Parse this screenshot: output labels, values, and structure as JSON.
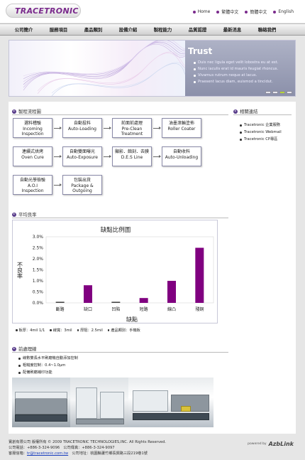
{
  "header": {
    "logo": "TRACETRONIC",
    "links": [
      "Home",
      "繁體中文",
      "簡體中文",
      "English"
    ]
  },
  "nav": {
    "items": [
      "公司簡介",
      "服務項目",
      "產品類別",
      "設備介紹",
      "製程能力",
      "品質認證",
      "最新消息",
      "聯絡我們"
    ]
  },
  "banner": {
    "title": "Trust",
    "items": [
      "Duis nec ligula eget velit lobostra eu at est.",
      "Nunc iaculis erat id mauris feugiat rhoncus.",
      "Vivamus rutrum neque at lacus.",
      "Praesent lacus diam, euismod a tincidut."
    ],
    "pages": 4,
    "active_page": 3
  },
  "flow": {
    "title": "製程流程圖",
    "steps": [
      {
        "zh": "選料稽驗",
        "en1": "Incoming",
        "en2": "Inspection"
      },
      {
        "zh": "自動投料",
        "en1": "Auto-Loading",
        "en2": ""
      },
      {
        "zh": "前面前處理",
        "en1": "Pre-Clean",
        "en2": "Treatment"
      },
      {
        "zh": "油墨滾輪塗佈",
        "en1": "Roller Coater",
        "en2": ""
      },
      {
        "zh": "連續式烘烤",
        "en1": "Oven Cure",
        "en2": ""
      },
      {
        "zh": "自動雙面曝光",
        "en1": "Auto-Exposure",
        "en2": ""
      },
      {
        "zh": "顯影．蝕刻．去膜",
        "en1": "D.E.S Line",
        "en2": ""
      },
      {
        "zh": "自動收料",
        "en1": "Auto-Unloading",
        "en2": ""
      },
      {
        "zh": "自動光學檢驗",
        "en1": "A.O.I",
        "en2": "Inspection"
      },
      {
        "zh": "包裝出貨",
        "en1": "Package &",
        "en2": "Outgoing"
      }
    ]
  },
  "related": {
    "title": "相關連結",
    "links": [
      "Tracetronic 企業服務",
      "Tracetronic Webmail",
      "Tracetronic CP專區"
    ]
  },
  "yield": {
    "title": "平均良率",
    "legend": [
      "板厚：4mil 1/1",
      "線寬：3mil",
      "厚阻：2.5mil",
      "產品類別：手機板"
    ]
  },
  "chart_data": {
    "type": "bar",
    "title": "缺點比例圖",
    "xlabel": "缺點",
    "ylabel": "不良率",
    "categories": [
      "斷路",
      "缺口",
      "凹陷",
      "短路",
      "線凸",
      "殘銅"
    ],
    "values": [
      0.05,
      0.8,
      0.05,
      0.22,
      1.0,
      2.5
    ],
    "yticks": [
      "3.0%",
      "2.5%",
      "2.0%",
      "1.5%",
      "1.0%",
      "0.5%",
      "0.0%"
    ],
    "ylim": [
      0,
      3.0
    ],
    "bar_color": "#800080",
    "grid": false
  },
  "process": {
    "title": "前處理線",
    "items": [
      "線數雙長水平刷磨機自動添加控制",
      "粗糙度控制：0.4~1.0μm",
      "配備刷磨補印功能"
    ]
  },
  "footer": {
    "line1": "實創有限公司 版權所有 © 2009 TRACETRONIC TECHNOLOGIES,INC. All Rights Reserved.",
    "line2": "公司電話：+886-3-324-9096　公司傳真：+886-3-324-9097",
    "line3_label": "客服信箱：",
    "email": "tr@tracetronic.com.tw",
    "line3_rest": "　公司地址：桃園縣蘆竹鄉長興路三段219巷1號",
    "powered_label": "powered by",
    "powered_brand": "AzbLink"
  }
}
